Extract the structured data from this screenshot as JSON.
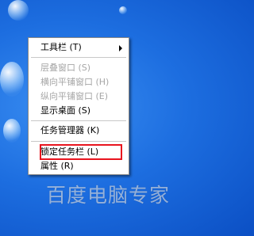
{
  "context_menu": {
    "items": [
      {
        "label": "工具栏 (T)",
        "disabled": false
      },
      {
        "label": "层叠窗口 (S)",
        "disabled": true
      },
      {
        "label": "横向平铺窗口 (H)",
        "disabled": true
      },
      {
        "label": "纵向平铺窗口 (E)",
        "disabled": true
      },
      {
        "label": "显示桌面 (S)",
        "disabled": false
      },
      {
        "label": "任务管理器 (K)",
        "disabled": false
      },
      {
        "label": "锁定任务栏 (L)",
        "disabled": false
      },
      {
        "label": "属性 (R)",
        "disabled": false
      }
    ]
  },
  "watermark": "百度电脑专家",
  "colors": {
    "desktop_blue": "#1d6ee0",
    "highlight_box": "#e8141e",
    "disabled_text": "#a6a6a6"
  }
}
